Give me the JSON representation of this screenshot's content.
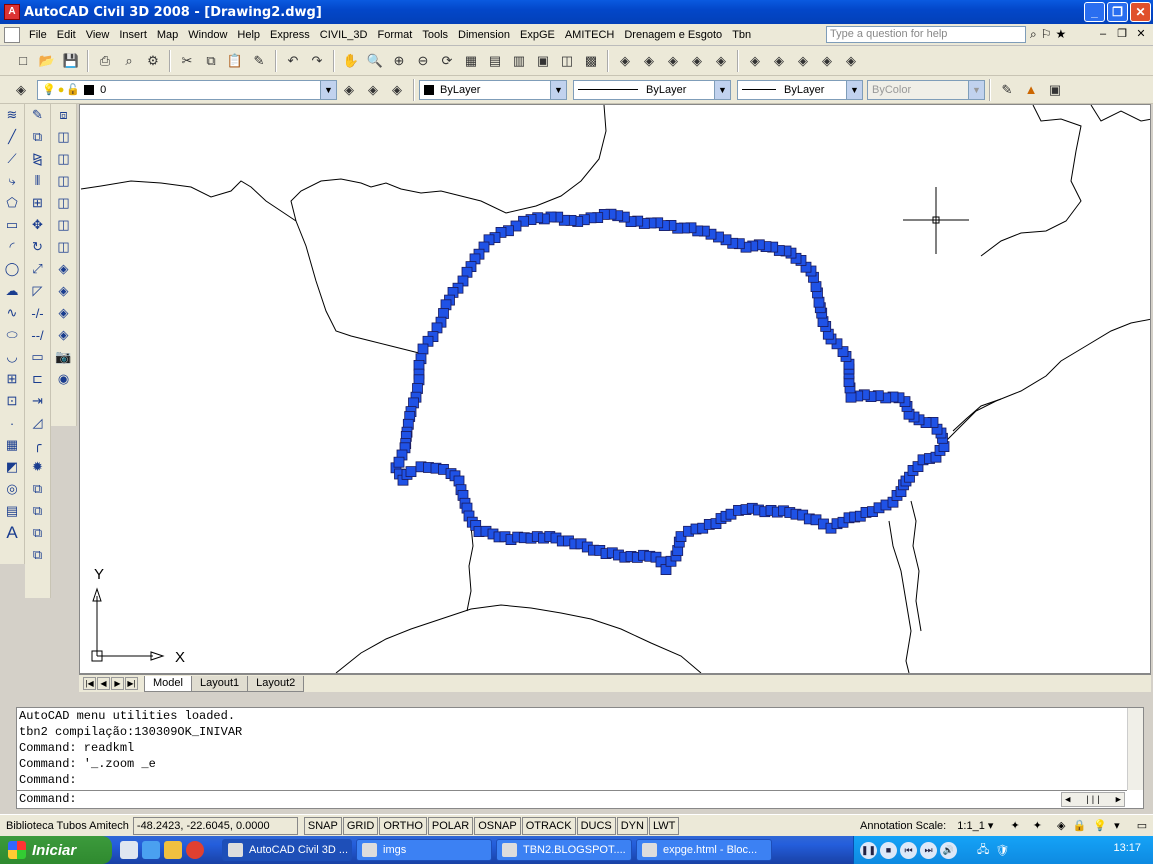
{
  "window": {
    "title": "AutoCAD Civil 3D 2008 - [Drawing2.dwg]"
  },
  "menu": {
    "items": [
      "File",
      "Edit",
      "View",
      "Insert",
      "Map",
      "Window",
      "Help",
      "Express",
      "CIVIL_3D",
      "Format",
      "Tools",
      "Dimension",
      "ExpGE",
      "AMITECH",
      "Drenagem e Esgoto",
      "Tbn"
    ],
    "help_placeholder": "Type a question for help"
  },
  "properties": {
    "layer": "0",
    "color": "ByLayer",
    "linetype": "ByLayer",
    "lineweight": "ByLayer",
    "plotstyle": "ByColor"
  },
  "layout_tabs": [
    "Model",
    "Layout1",
    "Layout2"
  ],
  "active_tab": "Model",
  "command_history": [
    "AutoCAD menu utilities loaded.",
    "tbn2 compilação:130309OK_INIVAR",
    "Command: readkml",
    "Command: '_.zoom _e",
    "Command:"
  ],
  "command_prompt": "Command:",
  "ucs": {
    "x_label": "X",
    "y_label": "Y"
  },
  "status": {
    "app_label": "Biblioteca Tubos Amitech",
    "coordinates": "-48.2423, -22.6045, 0.0000",
    "toggles": [
      "SNAP",
      "GRID",
      "ORTHO",
      "POLAR",
      "OSNAP",
      "OTRACK",
      "DUCS",
      "DYN",
      "LWT"
    ],
    "annotation_scale_label": "Annotation Scale:",
    "annotation_scale_value": "1:1_1"
  },
  "taskbar": {
    "start_label": "Iniciar",
    "tasks": [
      "AutoCAD Civil 3D ...",
      "imgs",
      "TBN2.BLOGSPOT....",
      "expge.html - Bloc..."
    ],
    "clock": "13:17"
  },
  "colors": {
    "boundary_fill": "#1f52e6",
    "boundary_stroke": "#1a1a5a",
    "titlebar": "#0a5ae0"
  }
}
